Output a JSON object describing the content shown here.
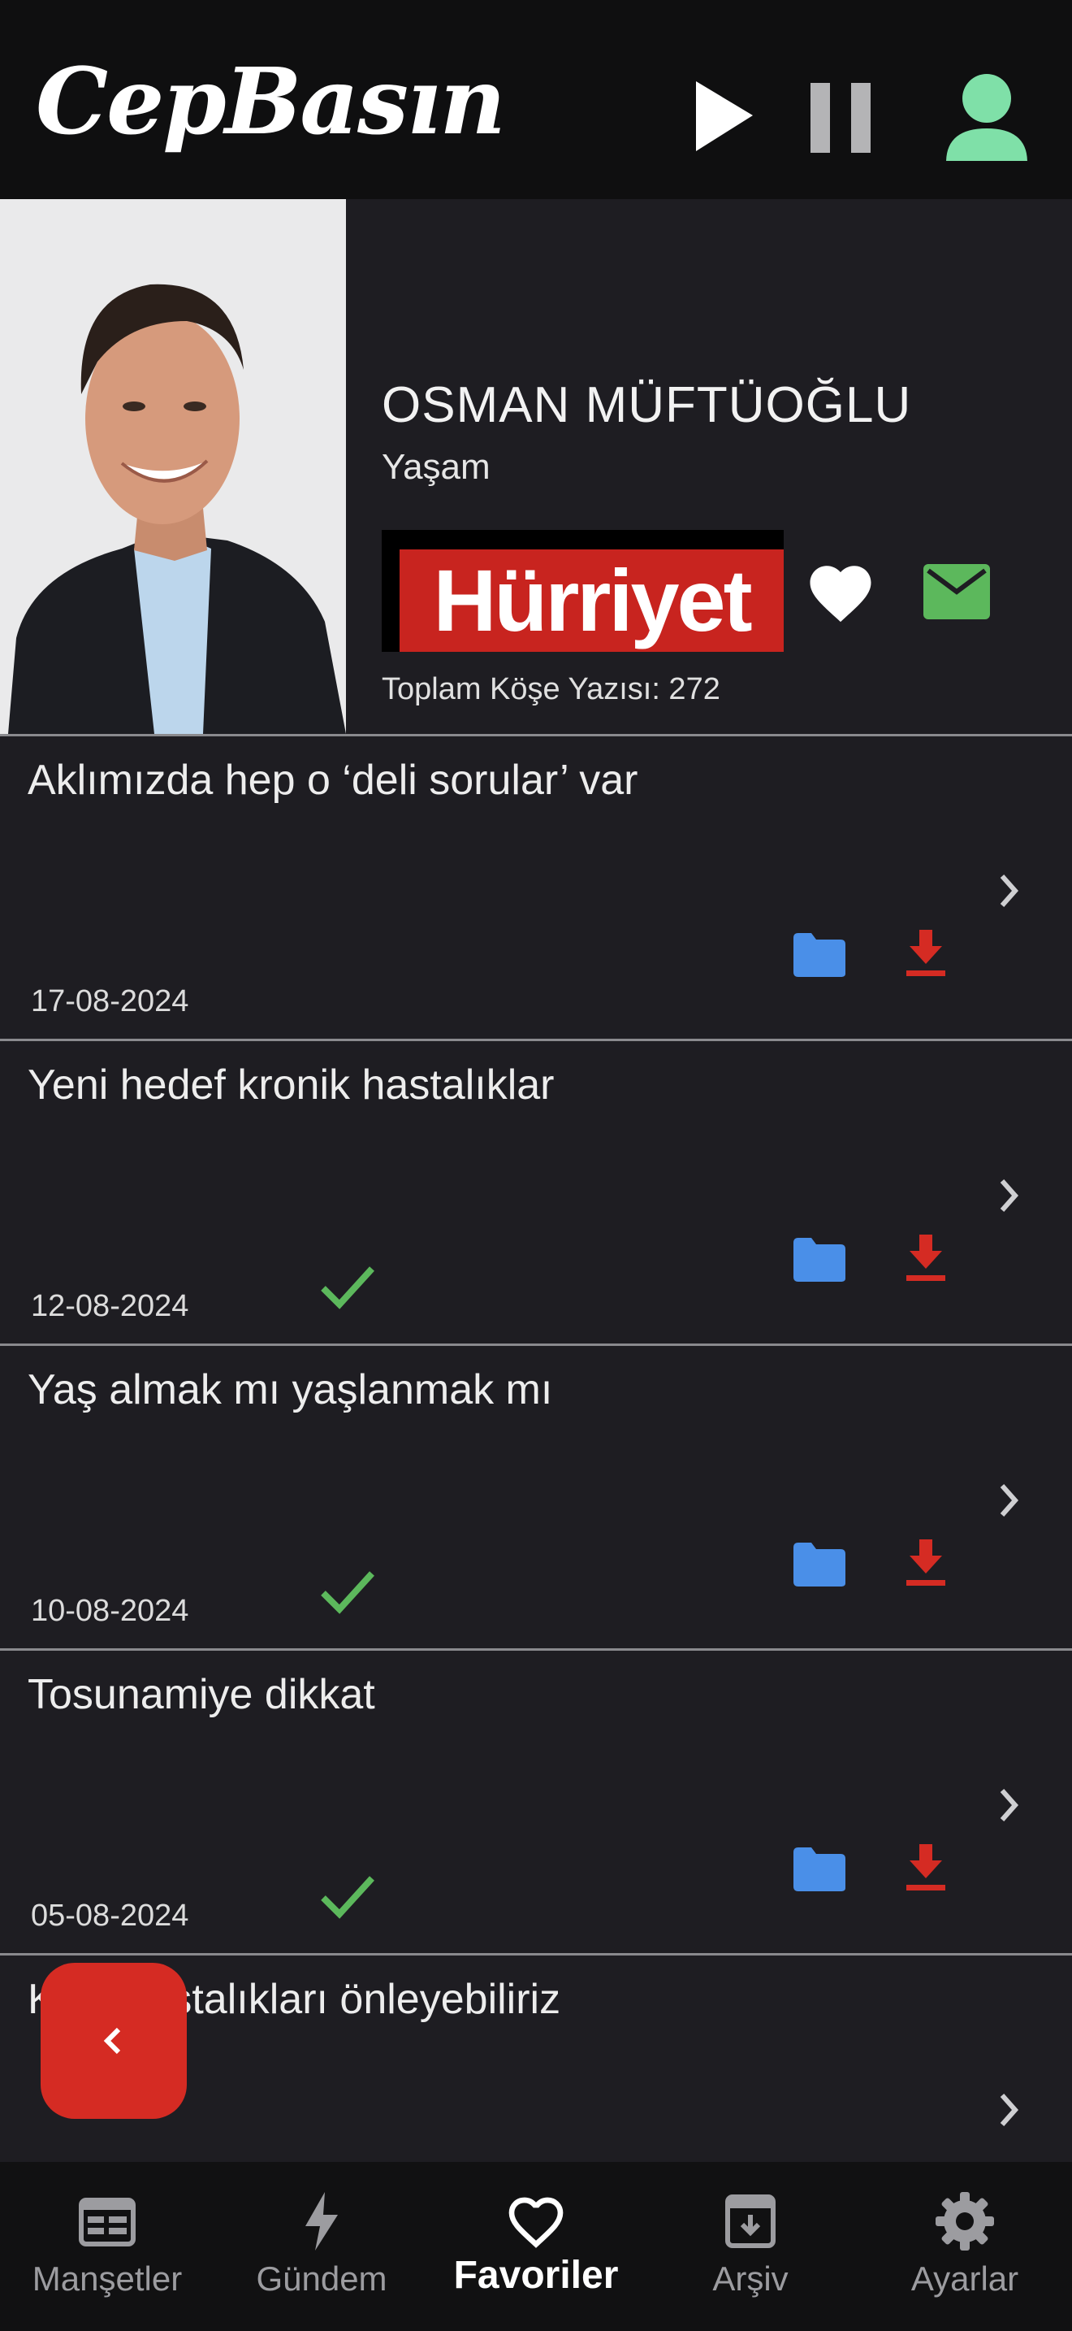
{
  "header": {
    "brand": "CepBasın",
    "play_icon": "play-icon",
    "pause_icon": "pause-icon",
    "profile_icon": "person-icon"
  },
  "author": {
    "name": "OSMAN MÜFTÜOĞLU",
    "category": "Yaşam",
    "newspaper_logo": "Hürriyet",
    "total_articles": "Toplam Köşe Yazısı: 272"
  },
  "articles": [
    {
      "title": "Aklımızda hep o ‘deli sorular’ var",
      "date": "17-08-2024",
      "read": false
    },
    {
      "title": "Yeni hedef kronik hastalıklar",
      "date": "12-08-2024",
      "read": true
    },
    {
      "title": "Yaş almak mı yaşlanmak mı",
      "date": "10-08-2024",
      "read": true
    },
    {
      "title": "Tosunamiye dikkat",
      "date": "05-08-2024",
      "read": true
    },
    {
      "title": "Kalp hastalıkları önleyebiliriz",
      "date": "",
      "read": false
    }
  ],
  "fab": {
    "icon": "chevron-left-icon"
  },
  "tabs": [
    {
      "label": "Manşetler",
      "icon": "newspaper-icon",
      "active": false
    },
    {
      "label": "Gündem",
      "icon": "bolt-icon",
      "active": false
    },
    {
      "label": "Favoriler",
      "icon": "heart-icon",
      "active": true
    },
    {
      "label": "Arşiv",
      "icon": "archive-icon",
      "active": false
    },
    {
      "label": "Ayarlar",
      "icon": "gear-icon",
      "active": false
    }
  ],
  "colors": {
    "background": "#1e1d22",
    "header": "#0f0f10",
    "accent_green": "#5cb85c",
    "profile_green": "#7fe0a8",
    "folder_blue": "#4a8fe8",
    "download_red": "#d52b23",
    "fab_red": "#d52b23"
  }
}
